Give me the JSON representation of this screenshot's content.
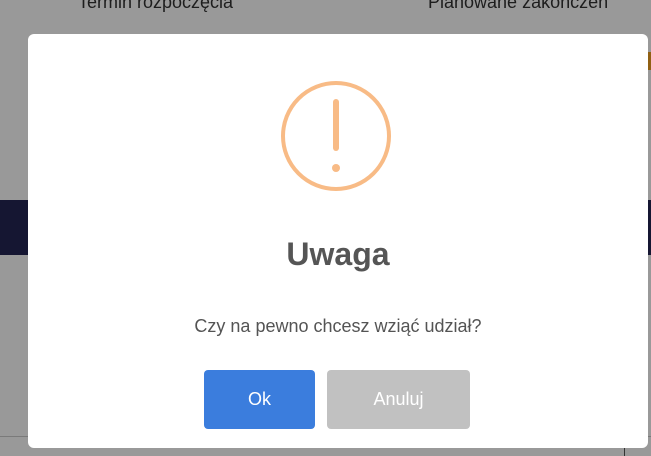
{
  "background": {
    "columns": [
      "Termin rozpoczęcia",
      "Planowane zakończen"
    ]
  },
  "dialog": {
    "icon": "warning-exclamation-icon",
    "icon_color": "#f8bb86",
    "title": "Uwaga",
    "message": "Czy na pewno chcesz wziąć udział?",
    "ok_label": "Ok",
    "cancel_label": "Anuluj",
    "ok_color": "#3b7ddd",
    "cancel_color": "#c1c1c1"
  }
}
